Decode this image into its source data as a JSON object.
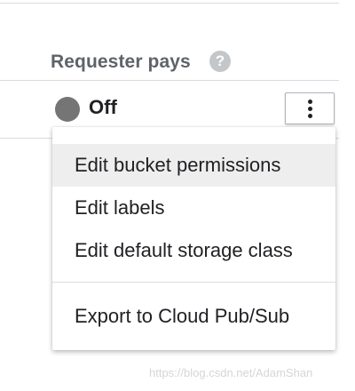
{
  "header": {
    "label": "Requester pays",
    "help_icon": "help-circle-icon",
    "help_glyph": "?"
  },
  "status": {
    "value": "Off",
    "dot_color": "#757575"
  },
  "more_button": {
    "icon": "more-vertical-icon"
  },
  "menu": {
    "items": [
      {
        "label": "Edit bucket permissions",
        "highlighted": true
      },
      {
        "label": "Edit labels",
        "highlighted": false
      },
      {
        "label": "Edit default storage class",
        "highlighted": false
      },
      {
        "label": "Export to Cloud Pub/Sub",
        "highlighted": false
      }
    ]
  },
  "watermark": "https://blog.csdn.net/AdamShan"
}
